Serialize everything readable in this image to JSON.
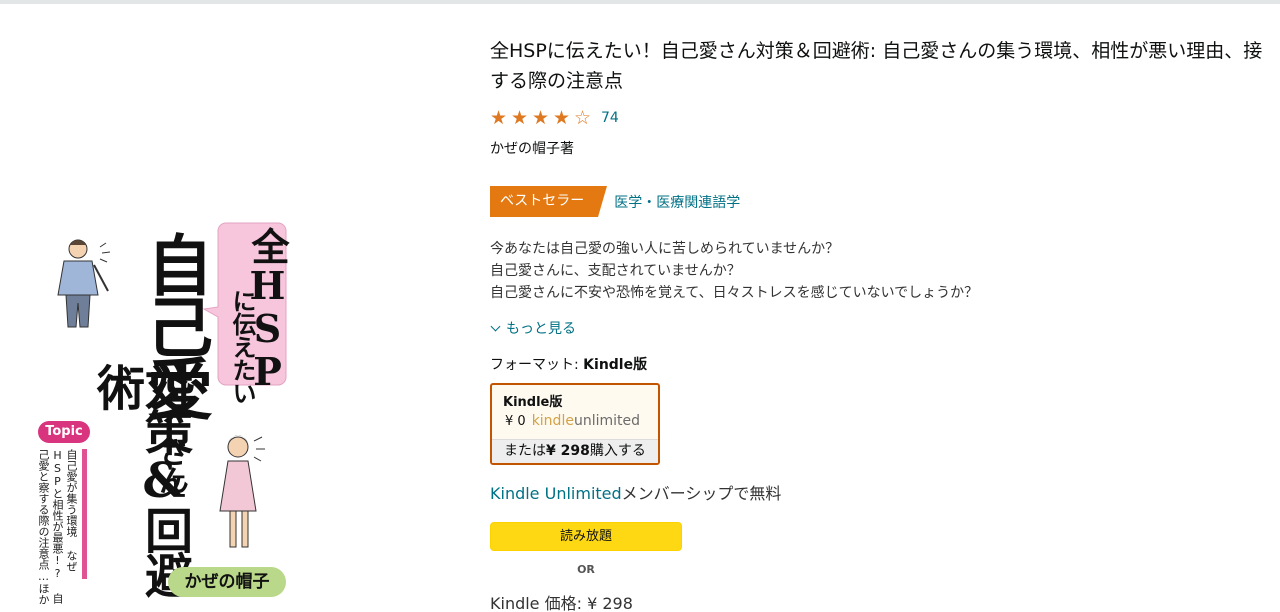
{
  "product": {
    "title": "全HSPに伝えたい！自己愛さん対策＆回避術: 自己愛さんの集う環境、相性が悪い理由、接する際の注意点",
    "rating": {
      "stars": 4,
      "max": 5,
      "count": "74"
    },
    "author_line": "かぜの帽子著",
    "badge": "ベストセラー",
    "badge_category": "医学・医療関連語学",
    "description": [
      "今あなたは自己愛の強い人に苦しめられていませんか？",
      "自己愛さんに、支配されていませんか？",
      "自己愛さんに不安や恐怖を覚えて、日々ストレスを感じていないでしょうか？"
    ],
    "see_more": "もっと見る",
    "format_label": "フォーマット: ",
    "format_value": "Kindle版",
    "format_box": {
      "title": "Kindle版",
      "price": "¥ 0",
      "ku_kindle": "kindle",
      "ku_unlimited": "unlimited",
      "buy_prefix": "または",
      "buy_price": "¥ 298",
      "buy_suffix": "購入する"
    },
    "ku_link": "Kindle Unlimited",
    "ku_suffix": "メンバーシップで無料",
    "read_button": "読み放題",
    "or": "OR",
    "kindle_price_label": "Kindle 価格: ",
    "kindle_price": "¥ 298"
  },
  "cover": {
    "zen_hsp": "全HSP",
    "ni_tsutaetai": "に伝えたい",
    "jikoai": "自己愛",
    "san": "さん",
    "taisaku": "対策&回避術",
    "topic": "Topic",
    "topics": "自己愛が集う環境 なぜHSPと相性が最悪!? 自己愛と察する際の注意点…ほか",
    "author": "かぜの帽子"
  },
  "colors": {
    "link": "#007185",
    "star": "#de7921",
    "badge": "#e47911",
    "button": "#ffd814",
    "selected_border": "#c45500"
  }
}
